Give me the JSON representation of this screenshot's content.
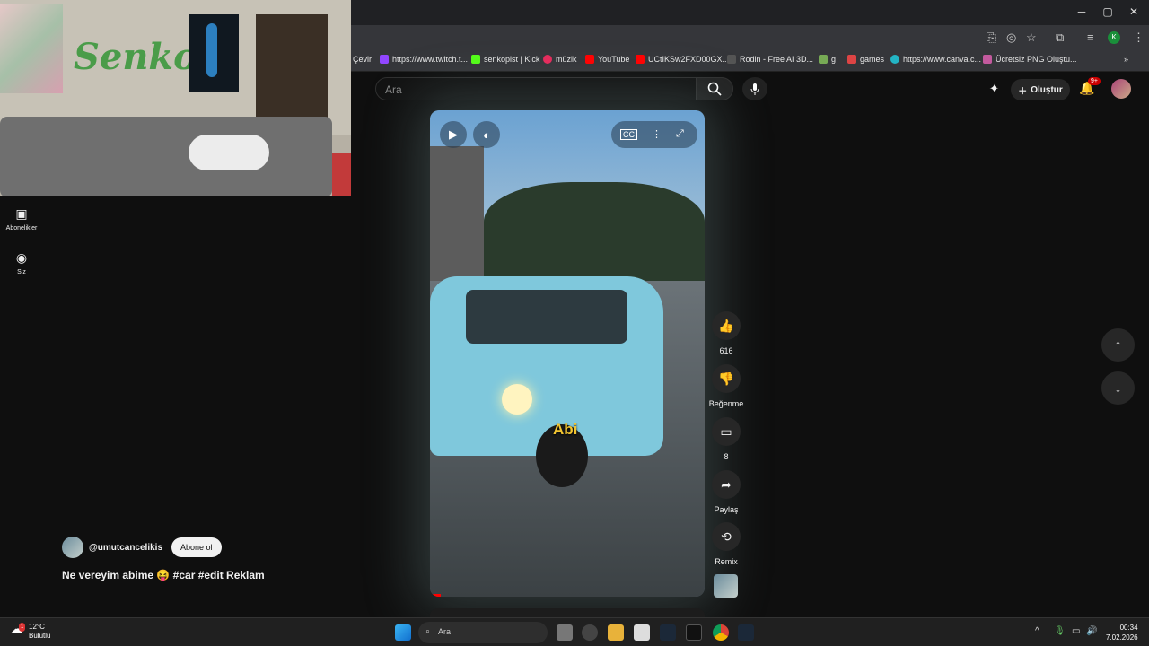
{
  "window": {
    "minimize": "─",
    "maximize": "▢",
    "close": "✕"
  },
  "bookmarks": [
    {
      "label": "Çevir",
      "color": "#888"
    },
    {
      "label": "https://www.twitch.t...",
      "color": "#9146ff"
    },
    {
      "label": "senkopist | Kick",
      "color": "#53fc18"
    },
    {
      "label": "müzik",
      "color": "#e62b5c"
    },
    {
      "label": "YouTube",
      "color": "#ff0000"
    },
    {
      "label": "UCtIKSw2FXD00GX...",
      "color": "#ff0000"
    },
    {
      "label": "Rodin - Free AI 3D...",
      "color": "#555"
    },
    {
      "label": "g",
      "color": "#7a5"
    },
    {
      "label": "games",
      "color": "#d44"
    },
    {
      "label": "https://www.canva.c...",
      "color": "#23b4c4"
    },
    {
      "label": "Ücretsiz PNG Oluştu...",
      "color": "#c35a9e"
    }
  ],
  "header": {
    "search_placeholder": "Ara",
    "create_label": "Oluştur",
    "notif_badge": "9+"
  },
  "sidebar": [
    {
      "label": "Abonelikler",
      "icon": "subscriptions-icon"
    },
    {
      "label": "Siz",
      "icon": "you-icon"
    }
  ],
  "webcam": {
    "graffiti": "Senko"
  },
  "video": {
    "caption": "Abi",
    "progress": 0.04
  },
  "actions": {
    "likes": "616",
    "dislike_label": "Beğenme",
    "comments": "8",
    "share_label": "Paylaş",
    "remix_label": "Remix"
  },
  "channel": {
    "handle": "@umutcancelikis",
    "subscribe_label": "Abone ol"
  },
  "description": "Ne vereyim abime 😝 #car #edit Reklam",
  "taskbar": {
    "temp": "12°C",
    "weather": "Bulutlu",
    "search": "Ara",
    "time": "00:34",
    "date": "7.02.2026",
    "weather_badge": "1"
  }
}
